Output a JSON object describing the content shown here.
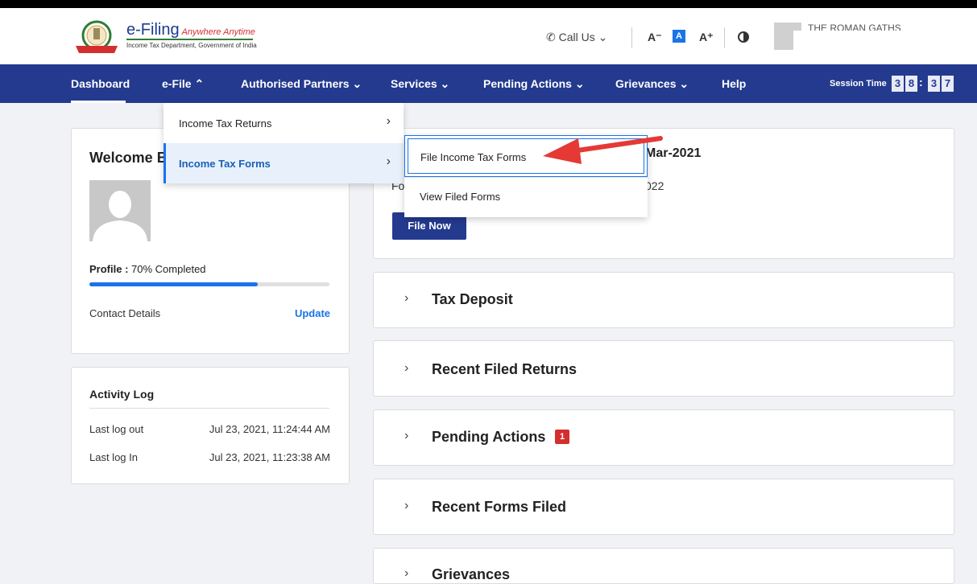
{
  "header": {
    "logo_title": "e-Filing",
    "logo_tagline": "Anywhere Anytime",
    "logo_subtitle": "Income Tax Department, Government of India",
    "call_us": "Call Us",
    "font_decrease": "A⁻",
    "font_normal": "A",
    "font_increase": "A⁺",
    "user_name": "THE ROMAN GATHS"
  },
  "nav": {
    "items": [
      {
        "label": "Dashboard"
      },
      {
        "label": "e-File ⌃"
      },
      {
        "label": "Authorised Partners ⌄"
      },
      {
        "label": "Services ⌄"
      },
      {
        "label": "Pending Actions ⌄"
      },
      {
        "label": "Grievances ⌄"
      },
      {
        "label": "Help"
      }
    ],
    "session_label": "Session Time",
    "session_digits": [
      "3",
      "8",
      "3",
      "7"
    ],
    "session_colon": ":"
  },
  "efile_menu": {
    "items": [
      {
        "label": "Income Tax Returns",
        "chevron": "›"
      },
      {
        "label": "Income Tax Forms",
        "chevron": "›"
      }
    ],
    "submenu": [
      {
        "label": "File Income Tax Forms"
      },
      {
        "label": "View Filed Forms"
      }
    ]
  },
  "profile_card": {
    "welcome": "Welcome B",
    "profile_prefix": "Profile :",
    "profile_value": "70% Completed",
    "progress_percent": 70,
    "contact_label": "Contact Details",
    "update_label": "Update"
  },
  "activity": {
    "title": "Activity Log",
    "rows": [
      {
        "label": "Last log out",
        "value": "Jul 23, 2021, 11:24:44 AM"
      },
      {
        "label": "Last log In",
        "value": "Jul 23, 2021, 11:23:38 AM"
      }
    ]
  },
  "itr_card": {
    "title_tail": "Mar-2021",
    "sub_left": "Fo",
    "sub_tail": "022",
    "file_now": "File Now"
  },
  "accordions": [
    {
      "title": "Tax Deposit"
    },
    {
      "title": "Recent Filed Returns"
    },
    {
      "title": "Pending Actions",
      "badge": "1"
    },
    {
      "title": "Recent Forms Filed"
    },
    {
      "title": "Grievances"
    }
  ],
  "colors": {
    "nav_blue": "#233a8f",
    "accent_blue": "#1a73e8",
    "arrow_red": "#e53935",
    "badge_red": "#d32f2f"
  },
  "icons": {
    "phone": "phone-icon",
    "contrast": "contrast-icon",
    "chevron": "chevron-right-icon",
    "arrow": "red-pointer-arrow-icon"
  }
}
